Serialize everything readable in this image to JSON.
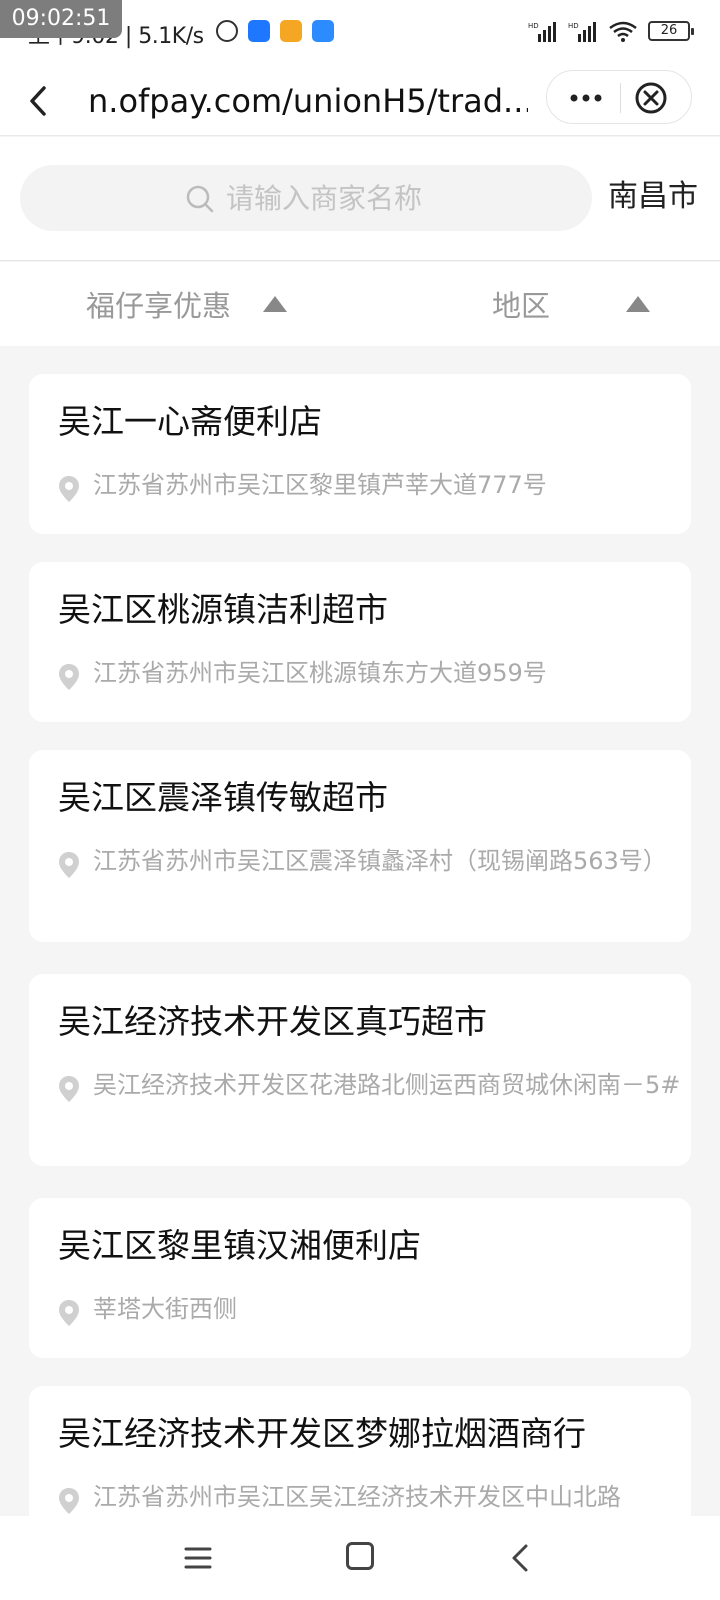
{
  "status_bar": {
    "time_overlay": "09:02:51",
    "text": "上午9:02 | 5.1K/s",
    "battery": "26"
  },
  "nav": {
    "url": "n.ofpay.com/unionH5/trad..."
  },
  "search": {
    "placeholder": "请输入商家名称",
    "city": "南昌市"
  },
  "filters": [
    {
      "label": "福仔享优惠"
    },
    {
      "label": "地区"
    }
  ],
  "stores": [
    {
      "name": "吴江一心斋便利店",
      "address": "江苏省苏州市吴江区黎里镇芦莘大道777号"
    },
    {
      "name": "吴江区桃源镇洁利超市",
      "address": "江苏省苏州市吴江区桃源镇东方大道959号"
    },
    {
      "name": "吴江区震泽镇传敏超市",
      "address": "江苏省苏州市吴江区震泽镇蠡泽村（现锡阐路563号）"
    },
    {
      "name": "吴江经济技术开发区真巧超市",
      "address": "吴江经济技术开发区花港路北侧运西商贸城休闲南－5#"
    },
    {
      "name": "吴江区黎里镇汉湘便利店",
      "address": "莘塔大街西侧"
    },
    {
      "name": "吴江经济技术开发区梦娜拉烟酒商行",
      "address": "江苏省苏州市吴江区吴江经济技术开发区中山北路"
    }
  ]
}
